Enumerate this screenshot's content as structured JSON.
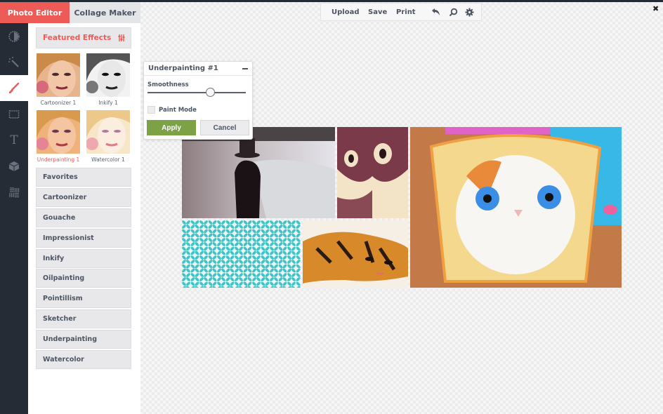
{
  "tabs": {
    "photo_editor": "Photo Editor",
    "collage_maker": "Collage Maker"
  },
  "toolbar": {
    "upload": "Upload",
    "save": "Save",
    "print": "Print",
    "icons": [
      "undo-icon",
      "search-icon",
      "gear-icon"
    ]
  },
  "rail": {
    "items": [
      {
        "icon": "exposure-icon",
        "active": false
      },
      {
        "icon": "magic-wand-icon",
        "active": false
      },
      {
        "icon": "paintbrush-icon",
        "active": true
      },
      {
        "icon": "frame-icon",
        "active": false
      },
      {
        "icon": "text-icon",
        "active": false,
        "glyph": "T"
      },
      {
        "icon": "cube-icon",
        "active": false
      },
      {
        "icon": "texture-icon",
        "active": false
      }
    ]
  },
  "panel": {
    "featured_label": "Featured Effects",
    "featured_icon": "sliders-icon",
    "thumbnails": [
      {
        "label": "Cartoonizer 1",
        "active": false
      },
      {
        "label": "Inkify 1",
        "active": false
      },
      {
        "label": "Underpainting 1",
        "active": true
      },
      {
        "label": "Watercolor 1",
        "active": false
      }
    ],
    "categories": [
      "Favorites",
      "Cartoonizer",
      "Gouache",
      "Impressionist",
      "Inkify",
      "Oilpainting",
      "Pointillism",
      "Sketcher",
      "Underpainting",
      "Watercolor"
    ]
  },
  "popup": {
    "title": "Underpainting #1",
    "smoothness_label": "Smoothness",
    "smoothness_value": 0.64,
    "paint_mode_label": "Paint Mode",
    "paint_mode_checked": false,
    "apply_label": "Apply",
    "cancel_label": "Cancel"
  },
  "colors": {
    "accent": "#ee5a55",
    "rail_bg": "#252c35",
    "apply": "#7da245",
    "pattern_teal": "#3fc3c6"
  },
  "close_icon": "close-icon"
}
